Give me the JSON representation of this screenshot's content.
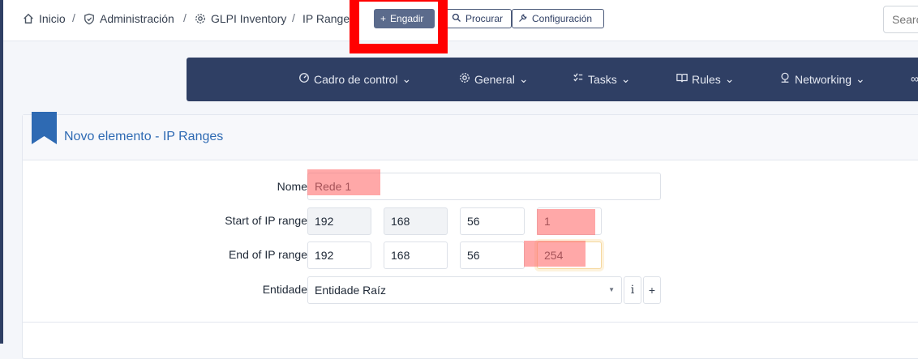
{
  "breadcrumb": {
    "home": "Inicio",
    "admin": "Administración",
    "plugin": "GLPI Inventory",
    "current": "IP Ranges",
    "separator": "/"
  },
  "toolbar": {
    "add_label": "Engadir",
    "search_label": "Procurar",
    "config_label": "Configuración"
  },
  "search": {
    "placeholder": "Search"
  },
  "nav": {
    "items": [
      {
        "label": "Cadro de control",
        "icon": "dashboard-icon"
      },
      {
        "label": "General",
        "icon": "gear-icon"
      },
      {
        "label": "Tasks",
        "icon": "tasks-icon"
      },
      {
        "label": "Rules",
        "icon": "book-icon"
      },
      {
        "label": "Networking",
        "icon": "network-icon"
      }
    ]
  },
  "form": {
    "title": "Novo elemento - IP Ranges",
    "name_label": "Nome",
    "name_value": "Rede 1",
    "start_label": "Start of IP range",
    "start_octets": [
      "192",
      "168",
      "56",
      "1"
    ],
    "end_label": "End of IP range",
    "end_octets": [
      "192",
      "168",
      "56",
      "254"
    ],
    "entity_label": "Entidade",
    "entity_value": "Entidade Raíz",
    "info_btn": "i",
    "add_btn": "+"
  },
  "colors": {
    "accent": "#2f3f64",
    "title": "#2e6ab3",
    "highlight": "#ff0000"
  }
}
